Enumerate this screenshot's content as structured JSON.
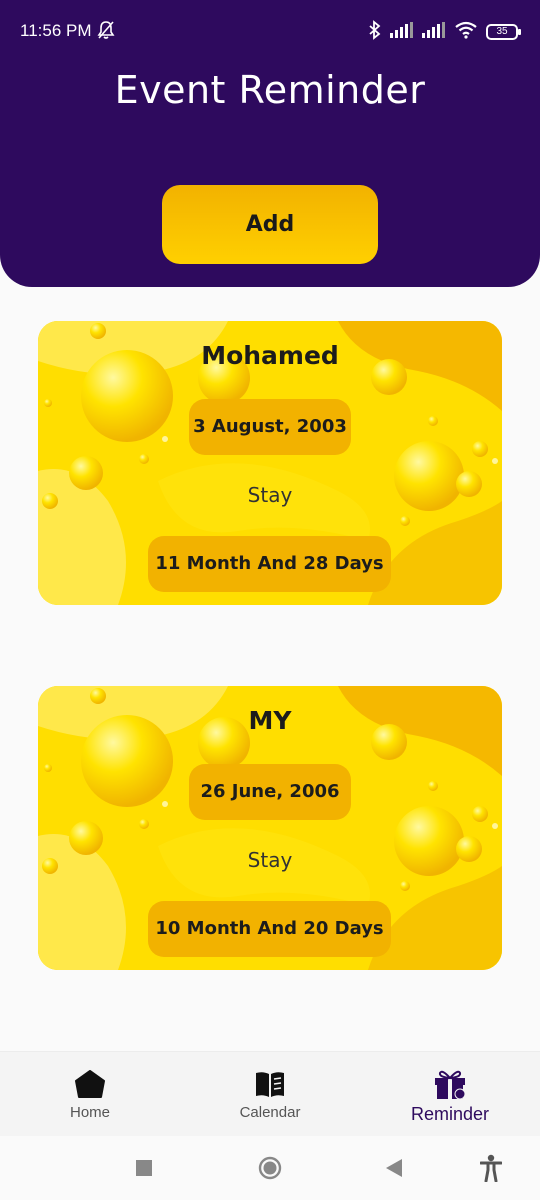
{
  "status_bar": {
    "time": "11:56 PM",
    "battery": "35"
  },
  "header": {
    "title": "Event Reminder",
    "add_label": "Add"
  },
  "events": [
    {
      "name": "Mohamed",
      "date": "3 August, 2003",
      "stay_label": "Stay",
      "duration": "11 Month And 28 Days"
    },
    {
      "name": "MY",
      "date": "26 June, 2006",
      "stay_label": "Stay",
      "duration": "10 Month And 20 Days"
    }
  ],
  "bottom_nav": {
    "items": [
      {
        "label": "Home",
        "icon": "home-icon"
      },
      {
        "label": "Calendar",
        "icon": "book-icon"
      },
      {
        "label": "Reminder",
        "icon": "gift-icon",
        "active": true
      }
    ]
  },
  "colors": {
    "primary": "#2e0a5e",
    "accent": "#ffd000",
    "pill": "#f2b200"
  }
}
